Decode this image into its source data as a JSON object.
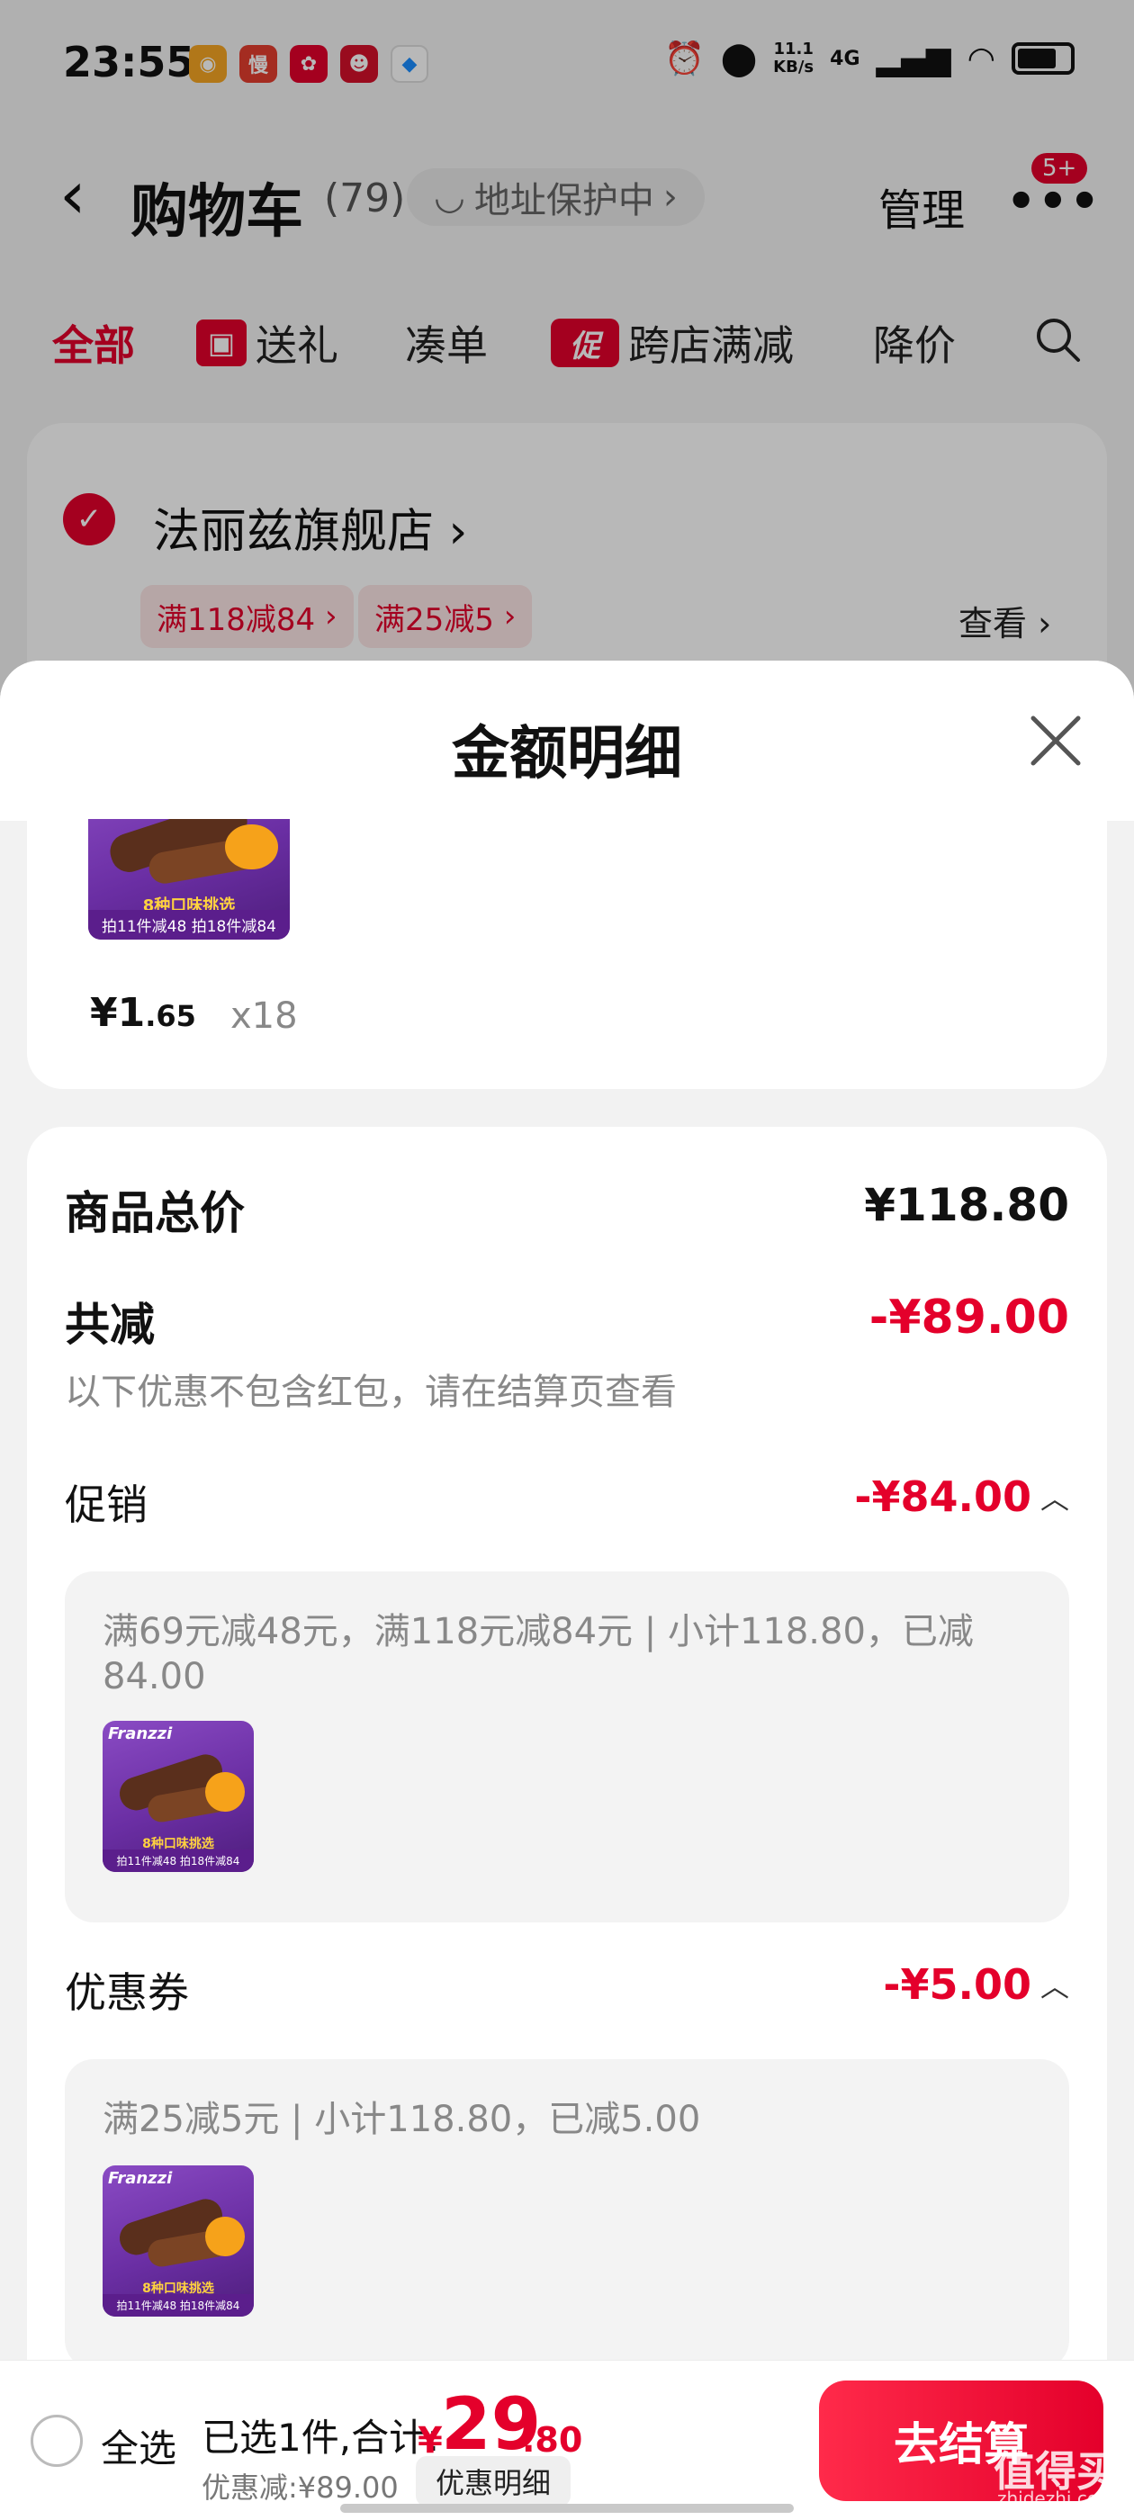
{
  "status_bar": {
    "time": "23:55",
    "net_speed_top": "11.1",
    "net_speed_bottom": "KB/s",
    "signal": "4G"
  },
  "nav": {
    "title": "购物车",
    "count": "(79)",
    "address_protect": "地址保护中",
    "manage": "管理",
    "badge": "5+"
  },
  "tabs": [
    {
      "label": "全部",
      "active": true
    },
    {
      "label": "送礼"
    },
    {
      "label": "凑单"
    },
    {
      "label": "跨店满减",
      "icon_text": "促"
    },
    {
      "label": "降价"
    }
  ],
  "store": {
    "name": "法丽兹旗舰店",
    "promos": [
      "满118减84",
      "满25减5"
    ],
    "view": "查看"
  },
  "sheet": {
    "title": "金额明细",
    "item": {
      "price_int": "¥1",
      "price_dec": ".65",
      "qty": "x18",
      "thumb_label": "拍11件减48  拍18件减84",
      "thumb_tag": "8种口味挑选",
      "thumb_brand": "Franzzi"
    },
    "summary": {
      "total_label": "商品总价",
      "total_value": "¥118.80",
      "reduce_label": "共减",
      "reduce_value": "-¥89.00",
      "note": "以下优惠不包含红包，请在结算页查看",
      "promo_label": "促销",
      "promo_value": "-¥84.00",
      "promo_detail": "满69元减48元，满118元减84元 | 小计118.80，已减84.00",
      "coupon_label": "优惠券",
      "coupon_value": "-¥5.00",
      "coupon_detail": "满25减5元 | 小计118.80，已减5.00"
    }
  },
  "checkout": {
    "select_all": "全选",
    "selected": "已选1件,合计:",
    "total_symbol": "¥",
    "total_int": "29",
    "total_dec": ".80",
    "discount": "优惠减:¥89.00",
    "detail_button": "优惠明细",
    "pay_button": "去结算"
  },
  "watermark": {
    "main": "值得买",
    "sub": "zhidezhi.com"
  },
  "colors": {
    "accent": "#e4002b",
    "promo_bg": "#fde6e6"
  }
}
